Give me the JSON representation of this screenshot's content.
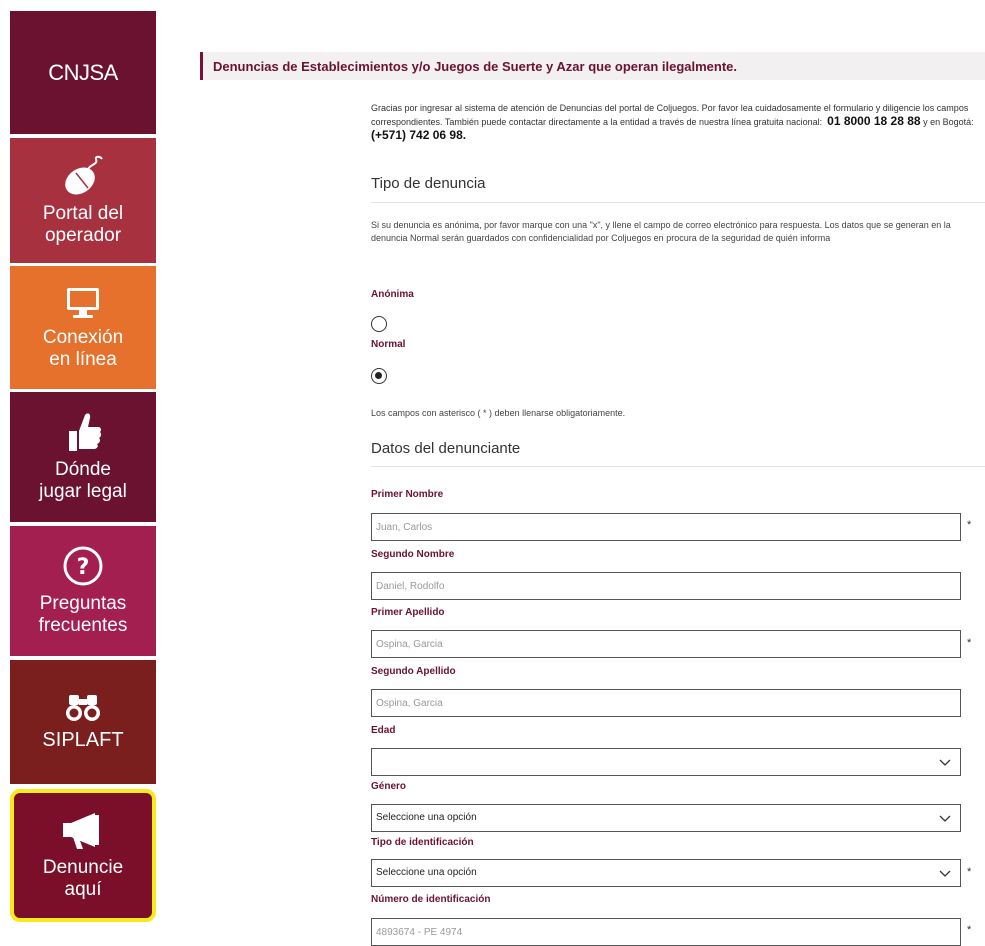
{
  "sidebar": {
    "items": [
      {
        "label": "CNJSA",
        "icon": "cnjsa"
      },
      {
        "label": "Portal del operador",
        "line1": "Portal del",
        "line2": "operador",
        "icon": "mouse-icon"
      },
      {
        "label": "Conexión en línea",
        "line1": "Conexión",
        "line2": "en línea",
        "icon": "monitor-icon"
      },
      {
        "label": "Dónde jugar legal",
        "line1": "Dónde",
        "line2": "jugar legal",
        "icon": "thumbs-up-icon"
      },
      {
        "label": "Preguntas frecuentes",
        "line1": "Preguntas",
        "line2": "frecuentes",
        "icon": "question-icon"
      },
      {
        "label": "SIPLAFT",
        "icon": "binoculars-icon"
      },
      {
        "label": "Denuncie aquí",
        "line1": "Denuncie",
        "line2": "aquí",
        "icon": "megaphone-icon"
      }
    ]
  },
  "header": {
    "title": "Denuncias de Establecimientos y/o Juegos de Suerte y Azar que operan ilegalmente."
  },
  "intro": {
    "text": "Gracias por ingresar al sistema de atención de Denuncias del portal de Coljuegos. Por favor lea cuidadosamente el formulario y diligencie los campos correspondientes. También puede contactar directamente a la entidad a través de nuestra línea gratuita nacional:",
    "phone_national": "01 8000 18 28 88",
    "bogota_text": "y en Bogotá:",
    "phone_bogota": "(+571) 742 06 98."
  },
  "tipo": {
    "title": "Tipo de denuncia",
    "note": "Si su denuncia es anónima, por favor marque con una \"x\", y llene el campo de correo electrónico para respuesta. Los datos que se generan en la denuncia Normal serán guardados con confidencialidad por Coljuegos en procura de la seguridad de quién informa",
    "option_anon": "Anónima",
    "option_normal": "Normal",
    "selected": "Normal"
  },
  "required_note": "Los campos con asterisco ( * ) deben llenarse obligatoriamente.",
  "datos": {
    "title": "Datos del denunciante",
    "fields": [
      {
        "label": "Primer Nombre",
        "placeholder": "Juan, Carlos",
        "required": "*"
      },
      {
        "label": "Segundo Nombre",
        "placeholder": "Daniel, Rodolfo",
        "required": ""
      },
      {
        "label": "Primer Apellido",
        "placeholder": "Ospina, Garcia",
        "required": "*"
      },
      {
        "label": "Segundo Apellido",
        "placeholder": "Ospina, Garcia",
        "required": ""
      },
      {
        "label": "Edad",
        "value": "",
        "required": ""
      },
      {
        "label": "Género",
        "value": "Seleccione una opción",
        "required": ""
      },
      {
        "label": "Tipo de identificación",
        "value": "Seleccione una opción",
        "required": "*"
      },
      {
        "label": "Número de identificación",
        "placeholder": "4893674 - PE 4974",
        "required": "*"
      }
    ]
  }
}
